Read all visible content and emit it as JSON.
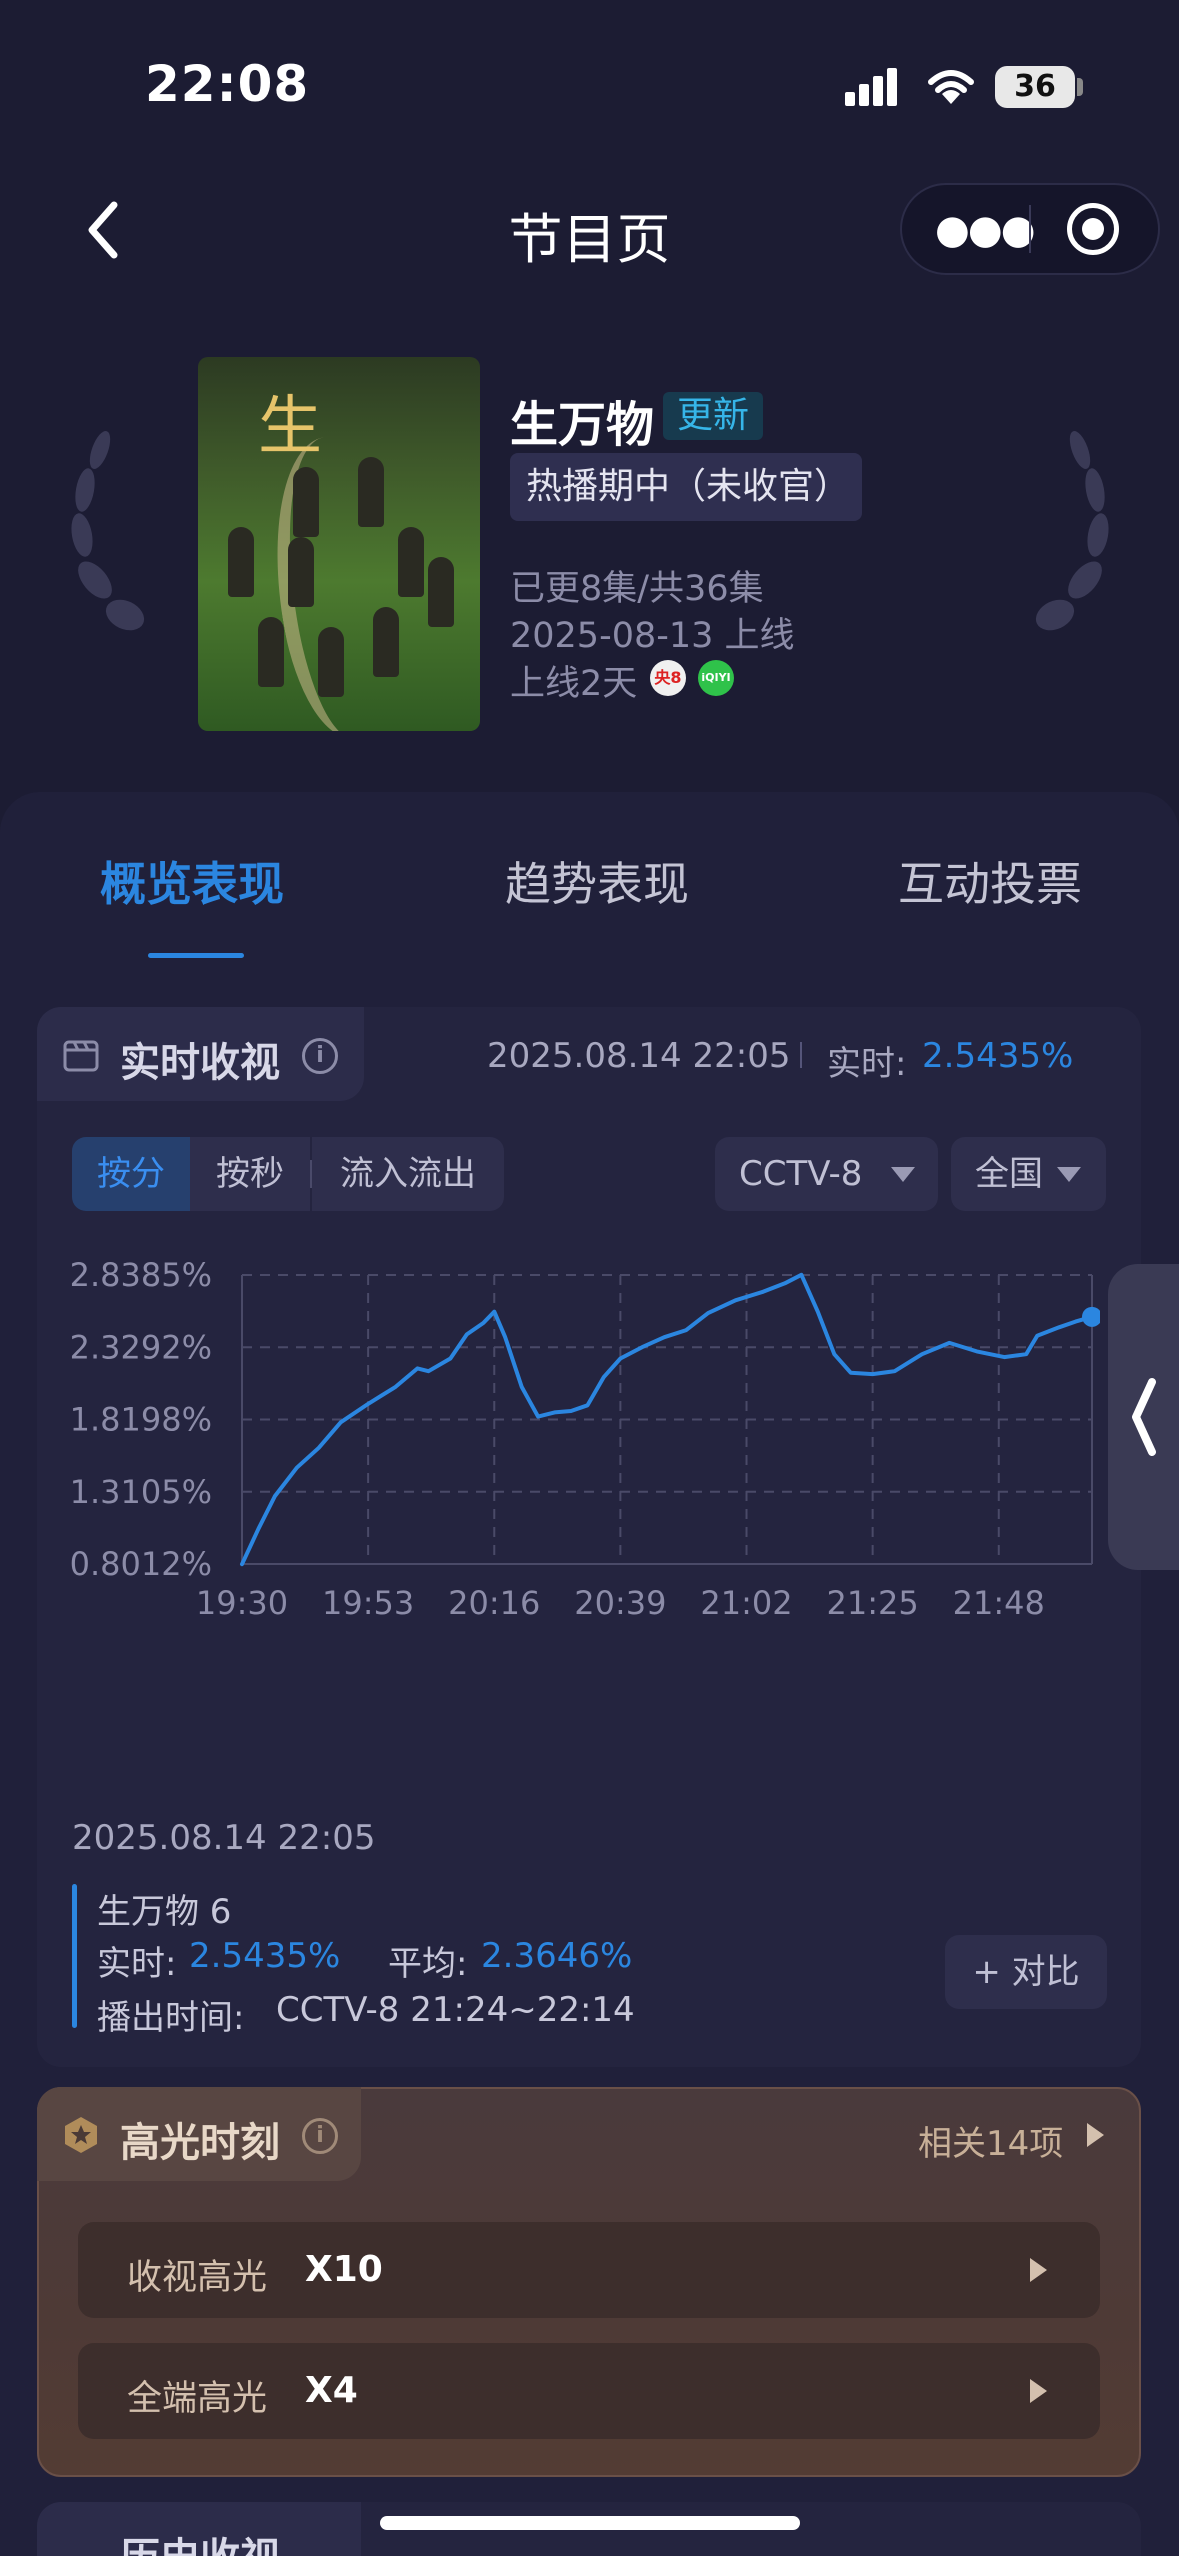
{
  "status_bar": {
    "time": "22:08",
    "battery": "36"
  },
  "nav": {
    "title": "节目页"
  },
  "program": {
    "title": "生万物",
    "update_tag": "更新",
    "status_tag": "热播期中（未收官）",
    "episodes": "已更8集/共36集",
    "release": "2025-08-13 上线",
    "online_days": "上线2天",
    "channel_badges": [
      "央8",
      "iQIYI"
    ],
    "poster_title_glyph": "生万物"
  },
  "tabs": [
    {
      "label": "概览表现",
      "active": true
    },
    {
      "label": "趋势表现",
      "active": false
    },
    {
      "label": "互动投票",
      "active": false
    }
  ],
  "realtime": {
    "title": "实时收视",
    "timestamp": "2025.08.14 22:05",
    "label": "实时:",
    "value": "2.5435%",
    "segments": [
      "按分",
      "按秒",
      "流入流出"
    ],
    "active_segment": "按分",
    "channel": "CCTV-8",
    "region": "全国"
  },
  "chart_data": {
    "type": "line",
    "x_ticks": [
      "19:30",
      "19:53",
      "20:16",
      "20:39",
      "21:02",
      "21:25",
      "21:48"
    ],
    "y_ticks": [
      "2.8385%",
      "2.3292%",
      "1.8198%",
      "1.3105%",
      "0.8012%"
    ],
    "ylim": [
      0.8012,
      2.8385
    ],
    "xlim": [
      "19:30",
      "22:05"
    ],
    "grid": true,
    "series": [
      {
        "color": "#2b86e0",
        "points": [
          [
            "19:30",
            0.8
          ],
          [
            "19:33",
            1.05
          ],
          [
            "19:36",
            1.28
          ],
          [
            "19:40",
            1.48
          ],
          [
            "19:44",
            1.62
          ],
          [
            "19:48",
            1.8
          ],
          [
            "19:53",
            1.93
          ],
          [
            "19:58",
            2.05
          ],
          [
            "20:02",
            2.18
          ],
          [
            "20:04",
            2.16
          ],
          [
            "20:08",
            2.25
          ],
          [
            "20:11",
            2.42
          ],
          [
            "20:14",
            2.5
          ],
          [
            "20:16",
            2.58
          ],
          [
            "20:18",
            2.4
          ],
          [
            "20:21",
            2.05
          ],
          [
            "20:24",
            1.84
          ],
          [
            "20:27",
            1.87
          ],
          [
            "20:30",
            1.88
          ],
          [
            "20:33",
            1.92
          ],
          [
            "20:36",
            2.12
          ],
          [
            "20:39",
            2.25
          ],
          [
            "20:43",
            2.33
          ],
          [
            "20:47",
            2.4
          ],
          [
            "20:51",
            2.45
          ],
          [
            "20:55",
            2.57
          ],
          [
            "21:00",
            2.66
          ],
          [
            "21:05",
            2.72
          ],
          [
            "21:09",
            2.78
          ],
          [
            "21:12",
            2.84
          ],
          [
            "21:15",
            2.58
          ],
          [
            "21:18",
            2.28
          ],
          [
            "21:21",
            2.15
          ],
          [
            "21:25",
            2.14
          ],
          [
            "21:29",
            2.16
          ],
          [
            "21:34",
            2.28
          ],
          [
            "21:39",
            2.36
          ],
          [
            "21:44",
            2.3
          ],
          [
            "21:49",
            2.26
          ],
          [
            "21:53",
            2.28
          ],
          [
            "21:55",
            2.41
          ],
          [
            "21:59",
            2.47
          ],
          [
            "22:02",
            2.51
          ],
          [
            "22:05",
            2.5435
          ]
        ]
      }
    ]
  },
  "legend": {
    "timestamp": "2025.08.14 22:05",
    "series_name": "生万物 6",
    "rt_label": "实时:",
    "rt_value": "2.5435%",
    "avg_label": "平均:",
    "avg_value": "2.3646%",
    "air_label": "播出时间:",
    "air_value": "CCTV-8 21:24~22:14",
    "compare": "+ 对比"
  },
  "highlights": {
    "title": "高光时刻",
    "related": "相关14项",
    "rows": [
      {
        "label": "收视高光",
        "value": "X10"
      },
      {
        "label": "全端高光",
        "value": "X4"
      }
    ]
  },
  "history": {
    "title": "历史收视"
  }
}
